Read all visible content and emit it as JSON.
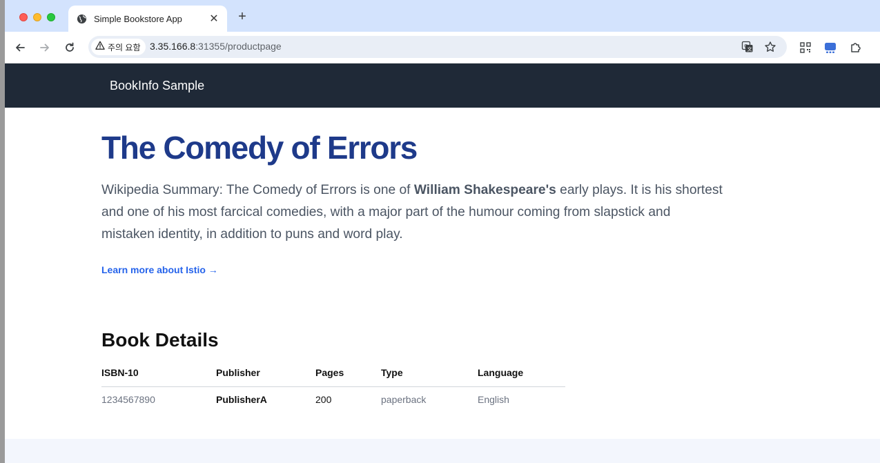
{
  "browser": {
    "tab": {
      "title": "Simple Bookstore App",
      "close_glyph": "✕"
    },
    "new_tab_glyph": "+",
    "security_label": "주의 요함",
    "url_host": "3.35.166.8",
    "url_rest": ":31355/productpage"
  },
  "site": {
    "brand": "BookInfo Sample"
  },
  "product": {
    "title": "The Comedy of Errors",
    "summary_before": "Wikipedia Summary: The Comedy of Errors is one of ",
    "summary_bold": "William Shakespeare's",
    "summary_after": " early plays. It is his shortest and one of his most farcical comedies, with a major part of the humour coming from slapstick and mistaken identity, in addition to puns and word play.",
    "learn_more": "Learn more about Istio →"
  },
  "details": {
    "heading": "Book Details",
    "columns": [
      "ISBN-10",
      "Publisher",
      "Pages",
      "Type",
      "Language"
    ],
    "rows": [
      [
        "1234567890",
        "PublisherA",
        "200",
        "paperback",
        "English"
      ]
    ]
  },
  "colors": {
    "navbar": "#1f2937",
    "title": "#1e3a8a",
    "link": "#2563eb",
    "tabstrip": "#d3e3fd"
  }
}
